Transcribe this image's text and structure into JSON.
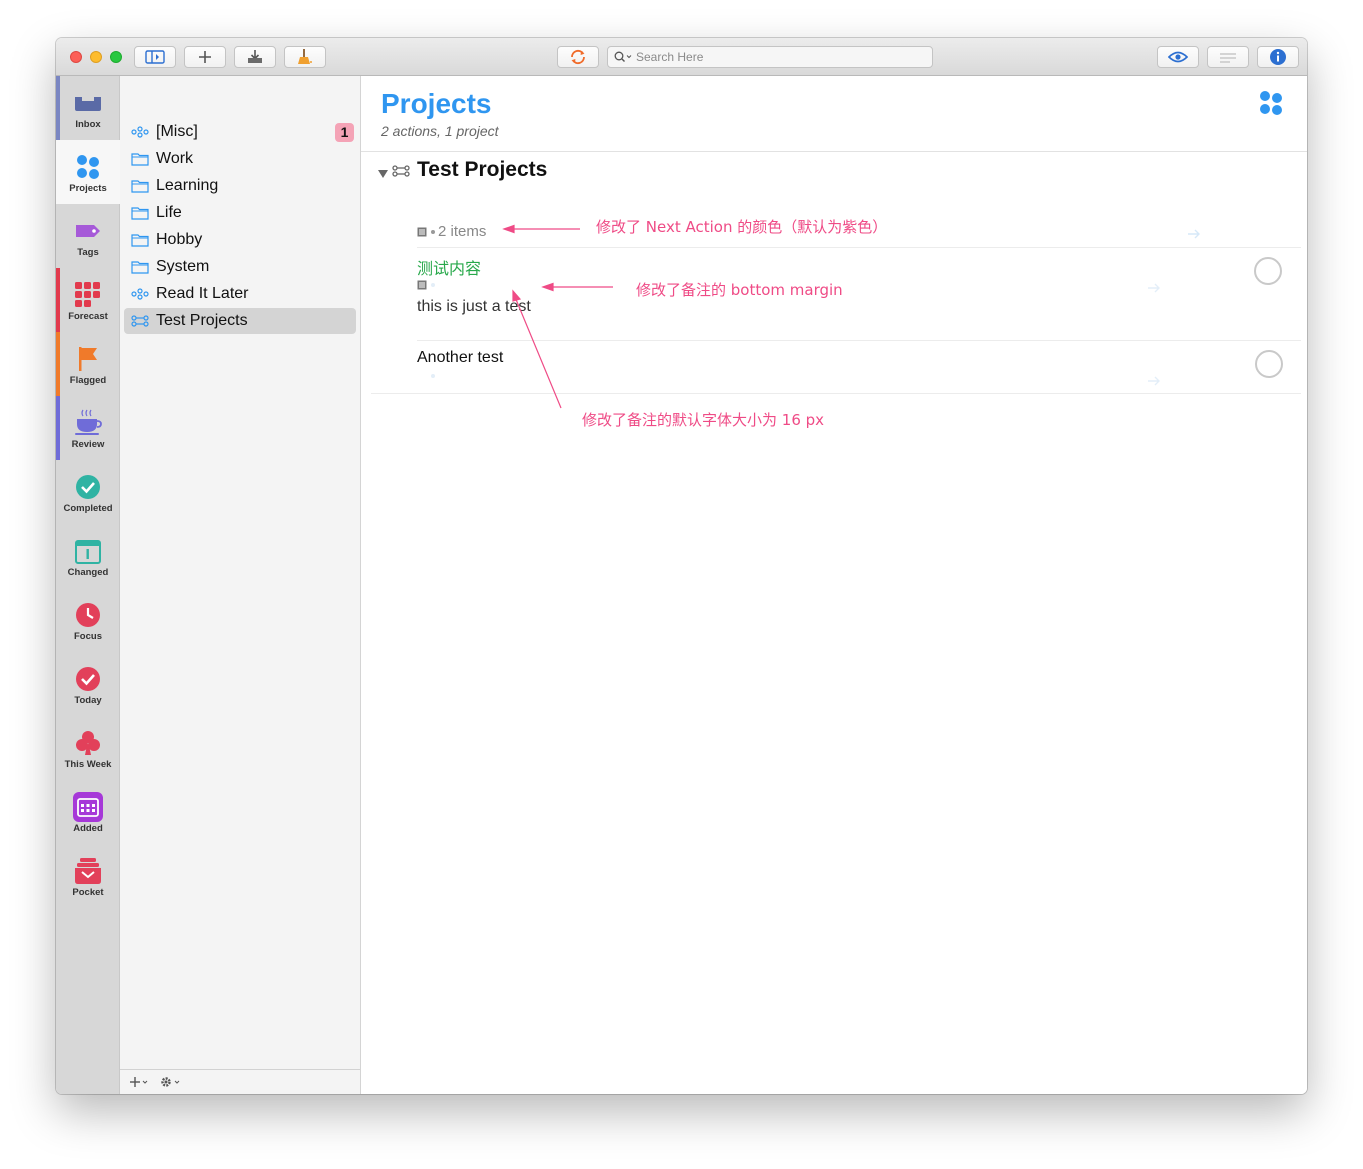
{
  "toolbar": {
    "search_placeholder": "Search Here"
  },
  "perspectives": [
    {
      "label": "Inbox",
      "icon": "inbox-icon"
    },
    {
      "label": "Projects",
      "icon": "projects-icon"
    },
    {
      "label": "Tags",
      "icon": "tag-icon"
    },
    {
      "label": "Forecast",
      "icon": "forecast-icon"
    },
    {
      "label": "Flagged",
      "icon": "flag-icon"
    },
    {
      "label": "Review",
      "icon": "review-cup-icon"
    },
    {
      "label": "Completed",
      "icon": "completed-check-icon"
    },
    {
      "label": "Changed",
      "icon": "calendar-changed-icon"
    },
    {
      "label": "Focus",
      "icon": "clock-focus-icon"
    },
    {
      "label": "Today",
      "icon": "today-check-icon"
    },
    {
      "label": "This Week",
      "icon": "club-this-week-icon"
    },
    {
      "label": "Added",
      "icon": "calendar-added-icon"
    },
    {
      "label": "Pocket",
      "icon": "pocket-icon"
    }
  ],
  "project_list": [
    {
      "label": "[Misc]",
      "icon": "single-actions-icon",
      "badge": "1"
    },
    {
      "label": "Work",
      "icon": "folder-icon"
    },
    {
      "label": "Learning",
      "icon": "folder-icon"
    },
    {
      "label": "Life",
      "icon": "folder-icon"
    },
    {
      "label": "Hobby",
      "icon": "folder-icon"
    },
    {
      "label": "System",
      "icon": "folder-icon"
    },
    {
      "label": "Read It Later",
      "icon": "single-actions-icon"
    },
    {
      "label": "Test Projects",
      "icon": "sequential-project-icon"
    }
  ],
  "main": {
    "title": "Projects",
    "subtitle": "2 actions, 1 project",
    "project": {
      "title": "Test Projects",
      "meta": "2 items"
    },
    "actions": [
      {
        "title": "测试内容",
        "note": "this is just a test"
      },
      {
        "title": "Another test",
        "note": ""
      }
    ]
  },
  "annotations": [
    "修改了 Next Action 的颜色（默认为紫色）",
    "修改了备注的 bottom margin",
    "修改了备注的默认字体大小为 16 px"
  ],
  "colors": {
    "accent_blue": "#2f96f0",
    "next_action_green": "#27a84a",
    "annotation_pink": "#ef4b86",
    "badge_pink": "#f4a3b6"
  }
}
